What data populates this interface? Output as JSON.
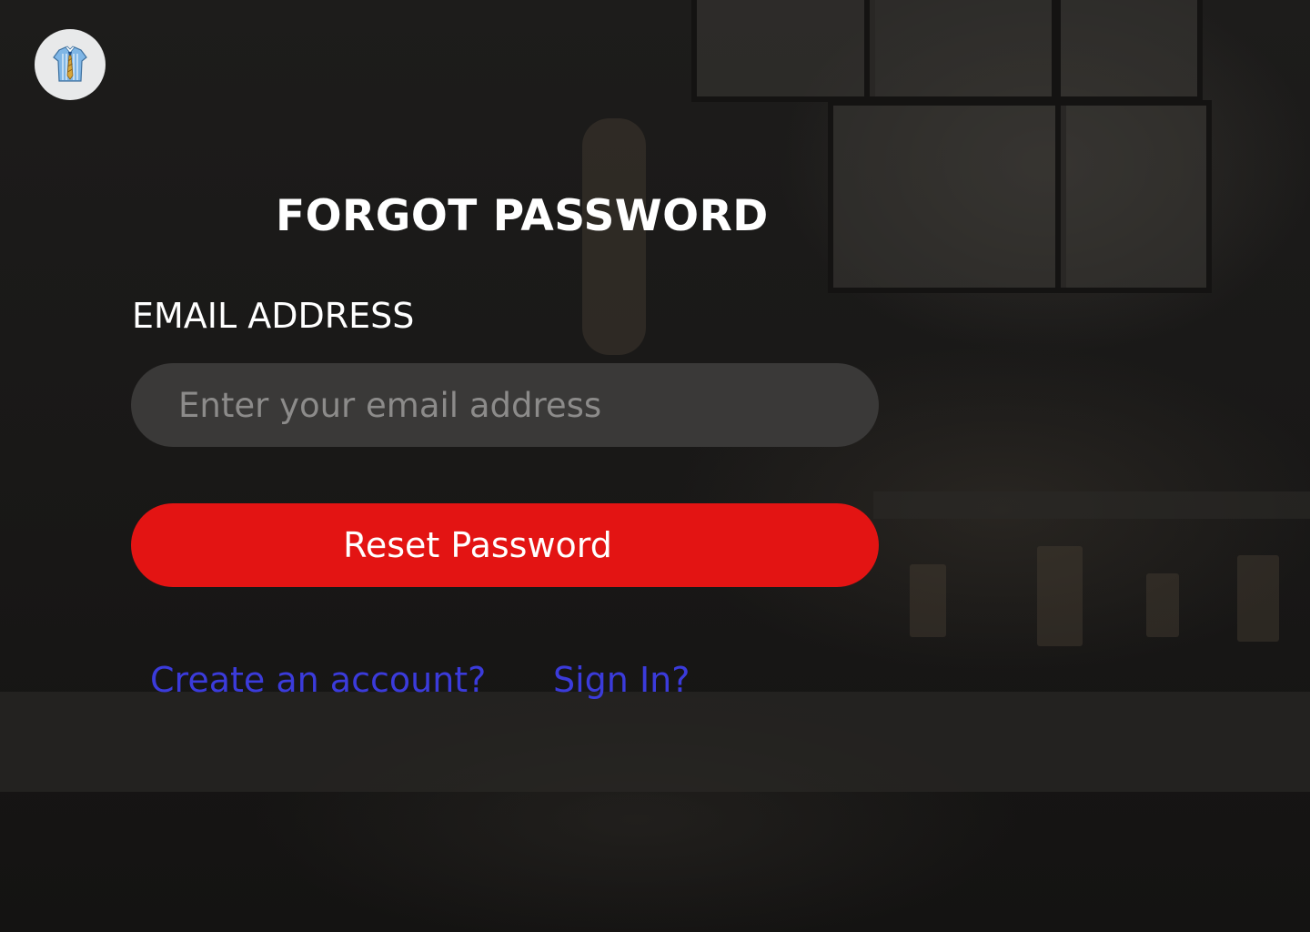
{
  "app": {
    "logo_icon": "shirt-tie-icon"
  },
  "form": {
    "title": "FORGOT PASSWORD",
    "email_label": "EMAIL ADDRESS",
    "email_placeholder": "Enter your email address",
    "email_value": "",
    "submit_label": "Reset Password"
  },
  "links": {
    "create_account": "Create an account?",
    "sign_in": "Sign In?"
  },
  "colors": {
    "background": "#1a1918",
    "input_background": "#3a3938",
    "primary_button": "#e31413",
    "link": "#3b3bdb",
    "text": "#ffffff"
  }
}
